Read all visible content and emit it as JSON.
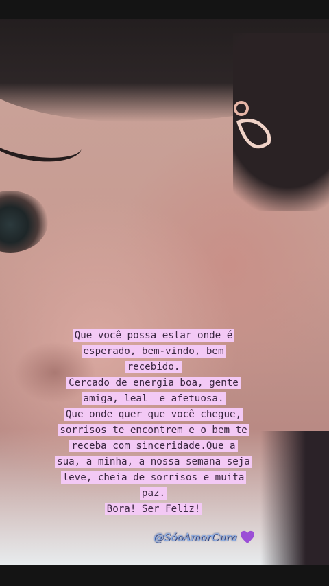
{
  "caption": {
    "lines": [
      "Que você possa estar onde é",
      "esperado, bem-vindo, bem",
      "recebido.",
      "Cercado de energia boa, gente",
      "amiga, leal  e afetuosa.",
      "Que onde quer que você chegue,",
      "sorrisos te encontrem e o bem te",
      "receba com sinceridade.Que a",
      "sua, a minha, a nossa semana seja",
      "leve, cheia de sorrisos e muita",
      "paz.",
      "Bora! Ser Feliz!"
    ]
  },
  "watermark": {
    "text": "@SóoAmorCura",
    "icon": "purple-heart-icon",
    "heart_color": "#9b4fd6"
  },
  "colors": {
    "highlight": "#f3c9f5",
    "text": "#3a2740"
  }
}
